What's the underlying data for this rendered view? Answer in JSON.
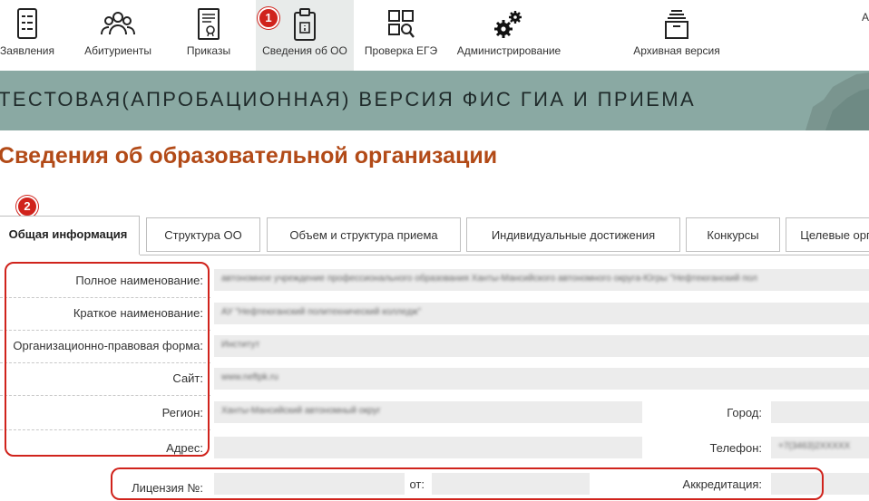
{
  "nav": {
    "items": [
      {
        "label": "Заявления",
        "icon": "applications-icon"
      },
      {
        "label": "Абитуриенты",
        "icon": "people-icon"
      },
      {
        "label": "Приказы",
        "icon": "orders-icon"
      },
      {
        "label": "Сведения об ОО",
        "icon": "organization-info-icon"
      },
      {
        "label": "Проверка ЕГЭ",
        "icon": "exam-check-icon"
      },
      {
        "label": "Администрирование",
        "icon": "gears-icon"
      },
      {
        "label": "Архивная версия",
        "icon": "archive-icon"
      }
    ],
    "user_initial": "А",
    "active_index": 3
  },
  "badges": {
    "first": "1",
    "second": "2"
  },
  "banner": {
    "title": "ТЕСТОВАЯ(АПРОБАЦИОННАЯ) ВЕРСИЯ ФИС ГИА И ПРИЕМА"
  },
  "page": {
    "title": "Сведения об образовательной организации"
  },
  "tabs": [
    {
      "label": "Общая информация"
    },
    {
      "label": "Структура ОО"
    },
    {
      "label": "Объем и структура приема"
    },
    {
      "label": "Индивидуальные достижения"
    },
    {
      "label": "Конкурсы"
    },
    {
      "label": "Целевые орг"
    }
  ],
  "form": {
    "full_name_label": "Полное наименование:",
    "full_name_value": "автономное учреждение профессионального образования Ханты-Мансийского автономного округа-Югры \"Нефтеюганский пол",
    "short_name_label": "Краткое наименование:",
    "short_name_value": "АУ \"Нефтеюганский политехнический колледж\"",
    "legal_form_label": "Организационно-правовая форма:",
    "legal_form_value": "Институт",
    "site_label": "Сайт:",
    "site_value": "www.neftpk.ru",
    "region_label": "Регион:",
    "region_value": "Ханты-Мансийский автономный округ",
    "city_label": "Город:",
    "city_value": "",
    "address_label": "Адрес:",
    "address_value": "",
    "phone_label": "Телефон:",
    "phone_value": "+7(3463)2XXXXX",
    "license_label": "Лицензия №:",
    "license_value": "",
    "license_from_label": "от:",
    "license_from_value": "",
    "accreditation_label": "Аккредитация:",
    "accreditation_value": ""
  },
  "colors": {
    "accent_title": "#b24a17",
    "banner_bg": "#8aa9a3",
    "callout_red": "#d0231c",
    "field_bg": "#ececec"
  }
}
